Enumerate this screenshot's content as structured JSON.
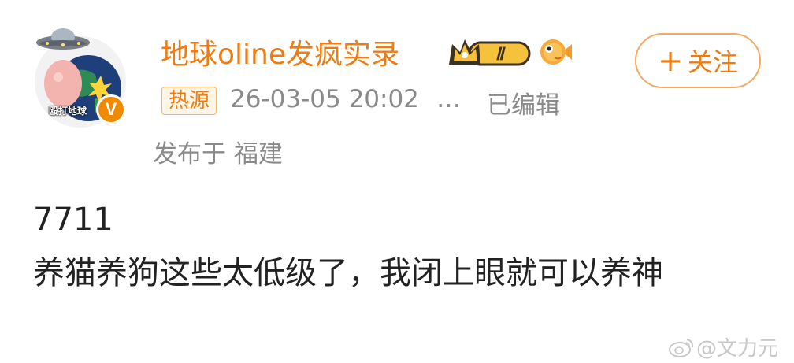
{
  "author": {
    "name": "地球oline发疯实录",
    "avatar_caption": "殴打地球",
    "verified_badge": "V",
    "level_badge": "Ⅱ",
    "brand_color": "#f07b10"
  },
  "follow": {
    "plus": "+",
    "label": "关注"
  },
  "meta": {
    "hot_tag": "热源",
    "timestamp": "26-03-05 20:02",
    "more": "…",
    "edited": "已编辑",
    "location": "发布于 福建"
  },
  "post": {
    "line1": "7711",
    "line2": "养猫养狗这些太低级了，我闭上眼就可以养神"
  },
  "watermark": {
    "text": "@文力元"
  },
  "icons": [
    "ufo-icon",
    "planet-icon",
    "verified-icon",
    "crown-icon",
    "fish-icon",
    "weibo-logo-icon"
  ]
}
